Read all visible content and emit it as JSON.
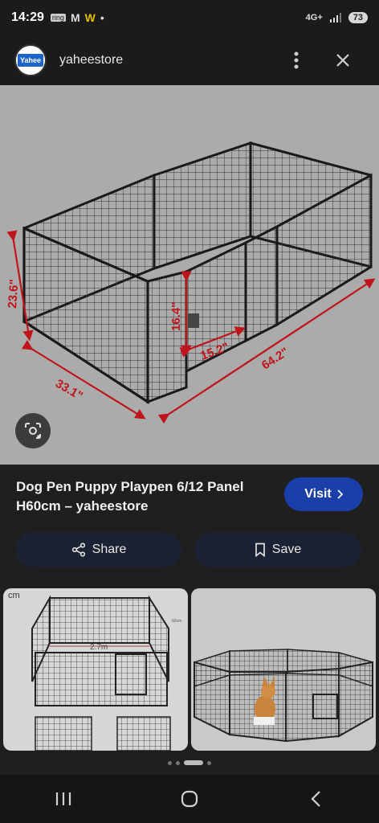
{
  "status_bar": {
    "time": "14:29",
    "notif_icons": [
      "ring",
      "M",
      "W"
    ],
    "dot": "•",
    "network": "4G+",
    "battery": "73"
  },
  "header": {
    "logo_text": "Yahee",
    "site_name": "yaheestore"
  },
  "main_image": {
    "dimensions": [
      "23.6\"",
      "16.4\"",
      "15.2\"",
      "33.1\"",
      "64.2\""
    ]
  },
  "result": {
    "title": "Dog Pen Puppy Playpen 6/12 Panel H60cm – yaheestore",
    "visit_label": "Visit",
    "share_label": "Share",
    "save_label": "Save"
  },
  "thumbnails": {
    "left_labels": [
      "cm",
      "2.7m"
    ],
    "left_labels_faint": [
      "60cm"
    ]
  },
  "colors": {
    "accent": "#1a3fa8",
    "dim_arrow": "#c0141c"
  }
}
